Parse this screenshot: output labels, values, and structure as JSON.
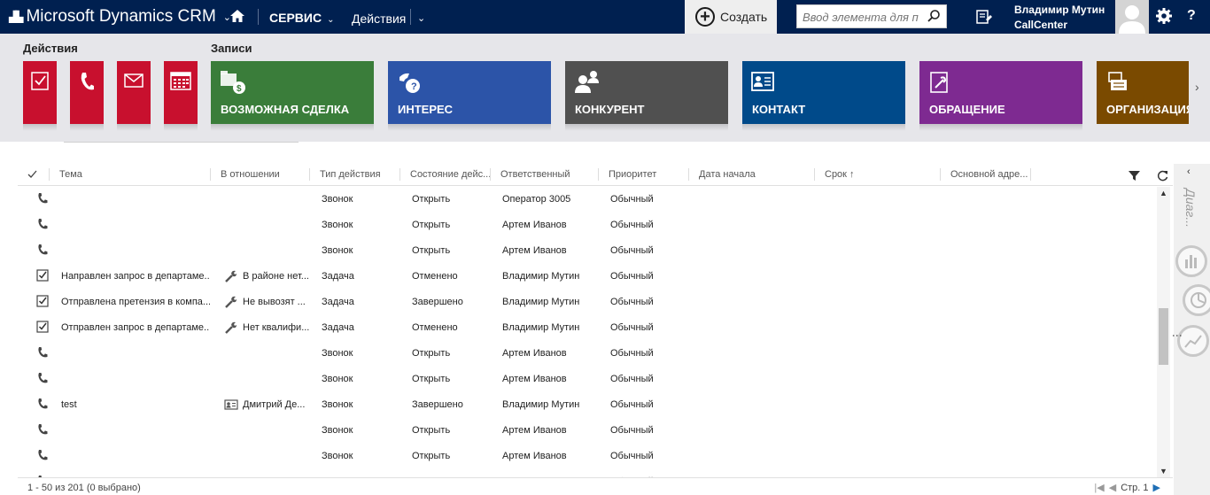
{
  "topnav": {
    "app_title": "Microsoft Dynamics CRM",
    "area": "СЕРВИС",
    "actions_label": "Действия",
    "create_label": "Создать",
    "search_placeholder": "Ввод элемента для п",
    "user_name": "Владимир Мутин",
    "user_org": "CallCenter",
    "help": "?"
  },
  "ribbon": {
    "actions_label": "Действия",
    "records_label": "Записи",
    "action_tiles": [
      {
        "icon": "task-icon"
      },
      {
        "icon": "phone-icon"
      },
      {
        "icon": "email-icon"
      },
      {
        "icon": "calendar-icon"
      }
    ],
    "record_tiles": [
      {
        "label": "ВОЗМОЖНАЯ СДЕЛКА",
        "color": "#3a7d3a",
        "icon": "opportunity-icon"
      },
      {
        "label": "ИНТЕРЕС",
        "color": "#2c54a8",
        "icon": "lead-icon"
      },
      {
        "label": "КОНКУРЕНТ",
        "color": "#505050",
        "icon": "competitor-icon"
      },
      {
        "label": "КОНТАКТ",
        "color": "#004a8a",
        "icon": "contact-icon"
      },
      {
        "label": "ОБРАЩЕНИЕ",
        "color": "#7e2a91",
        "icon": "case-icon"
      },
      {
        "label": "ОРГАНИЗАЦИЯ",
        "color": "#7a4a00",
        "icon": "account-icon"
      }
    ]
  },
  "grid": {
    "columns": {
      "subject": "Тема",
      "regarding": "В отношении",
      "activity_type": "Тип действия",
      "state": "Состояние дейс...",
      "owner": "Ответственный",
      "priority": "Приоритет",
      "start": "Дата начала",
      "due": "Срок ↑",
      "address": "Основной адре..."
    },
    "rows": [
      {
        "icon": "phone",
        "subject": "",
        "regarding": "",
        "reg_icon": "",
        "type": "Звонок",
        "state": "Открыть",
        "owner": "Оператор 3005",
        "priority": "Обычный"
      },
      {
        "icon": "phone",
        "subject": "",
        "regarding": "",
        "reg_icon": "",
        "type": "Звонок",
        "state": "Открыть",
        "owner": "Артем Иванов",
        "priority": "Обычный"
      },
      {
        "icon": "phone",
        "subject": "",
        "regarding": "",
        "reg_icon": "",
        "type": "Звонок",
        "state": "Открыть",
        "owner": "Артем Иванов",
        "priority": "Обычный"
      },
      {
        "icon": "task",
        "subject": "Направлен запрос в департаме...",
        "regarding": "В районе нет...",
        "reg_icon": "wrench",
        "type": "Задача",
        "state": "Отменено",
        "owner": "Владимир Мутин",
        "priority": "Обычный"
      },
      {
        "icon": "task",
        "subject": "Отправлена претензия в компа...",
        "regarding": "Не вывозят ...",
        "reg_icon": "wrench",
        "type": "Задача",
        "state": "Завершено",
        "owner": "Владимир Мутин",
        "priority": "Обычный"
      },
      {
        "icon": "task",
        "subject": "Отправлен запрос в департаме...",
        "regarding": "Нет квалифи...",
        "reg_icon": "wrench",
        "type": "Задача",
        "state": "Отменено",
        "owner": "Владимир Мутин",
        "priority": "Обычный"
      },
      {
        "icon": "phone",
        "subject": "",
        "regarding": "",
        "reg_icon": "",
        "type": "Звонок",
        "state": "Открыть",
        "owner": "Артем Иванов",
        "priority": "Обычный"
      },
      {
        "icon": "phone",
        "subject": "",
        "regarding": "",
        "reg_icon": "",
        "type": "Звонок",
        "state": "Открыть",
        "owner": "Артем Иванов",
        "priority": "Обычный"
      },
      {
        "icon": "phone",
        "subject": "test",
        "regarding": "Дмитрий Де...",
        "reg_icon": "contact",
        "type": "Звонок",
        "state": "Завершено",
        "owner": "Владимир Мутин",
        "priority": "Обычный"
      },
      {
        "icon": "phone",
        "subject": "",
        "regarding": "",
        "reg_icon": "",
        "type": "Звонок",
        "state": "Открыть",
        "owner": "Артем Иванов",
        "priority": "Обычный"
      },
      {
        "icon": "phone",
        "subject": "",
        "regarding": "",
        "reg_icon": "",
        "type": "Звонок",
        "state": "Открыть",
        "owner": "Артем Иванов",
        "priority": "Обычный"
      },
      {
        "icon": "phone",
        "subject": "",
        "regarding": "",
        "reg_icon": "",
        "type": "Звонок",
        "state": "Открыть",
        "owner": "Артем Иванов",
        "priority": "Обычный"
      }
    ],
    "footer_count": "1 - 50 из 201 (0 выбрано)",
    "page_label": "Стр. 1"
  },
  "right_panel": {
    "title": "Диаг..."
  }
}
